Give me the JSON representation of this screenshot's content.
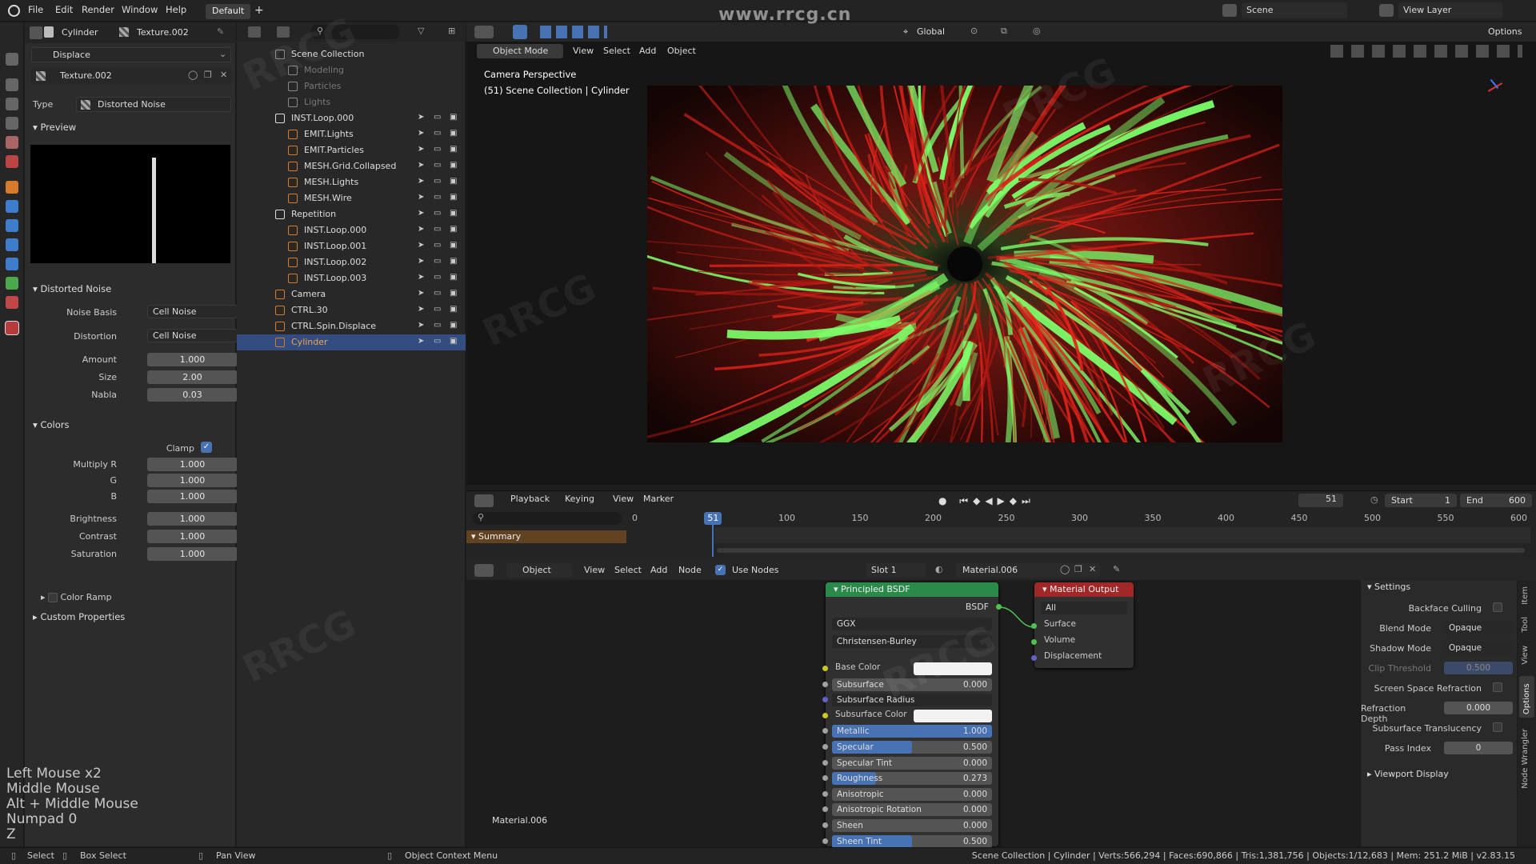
{
  "menu": {
    "items": [
      "File",
      "Edit",
      "Render",
      "Window",
      "Help"
    ],
    "workspace": "Default"
  },
  "topright": {
    "scene": "Scene",
    "view_layer": "View Layer"
  },
  "properties": {
    "object_name": "Cylinder",
    "texture_name": "Texture.002",
    "modifier": "Displace",
    "texture_field": "Texture.002",
    "type_label": "Type",
    "type_value": "Distorted Noise",
    "preview_label": "Preview",
    "noise_section": "Distorted Noise",
    "noise_basis_label": "Noise Basis",
    "noise_basis": "Cell Noise",
    "distortion_label": "Distortion",
    "distortion": "Cell Noise",
    "amount_label": "Amount",
    "amount": "1.000",
    "size_label": "Size",
    "size": "2.00",
    "nabla_label": "Nabla",
    "nabla": "0.03",
    "colors_section": "Colors",
    "clamp_label": "Clamp",
    "mult_r_label": "Multiply R",
    "mult_r": "1.000",
    "g_label": "G",
    "g": "1.000",
    "b_label": "B",
    "b": "1.000",
    "brightness_label": "Brightness",
    "brightness": "1.000",
    "contrast_label": "Contrast",
    "contrast": "1.000",
    "saturation_label": "Saturation",
    "saturation": "1.000",
    "color_ramp_label": "Color Ramp",
    "custom_props": "Custom Properties"
  },
  "keyhints": [
    "Left Mouse x2",
    "Middle Mouse",
    "Alt + Middle Mouse",
    "Numpad 0",
    "Z"
  ],
  "outliner": {
    "rows": [
      {
        "label": "Scene Collection",
        "dim": false
      },
      {
        "label": "Modeling",
        "dim": true
      },
      {
        "label": "Particles",
        "dim": true
      },
      {
        "label": "Lights",
        "dim": true
      },
      {
        "label": "INST.Loop.000",
        "dim": false
      },
      {
        "label": "EMIT.Lights",
        "dim": false
      },
      {
        "label": "EMIT.Particles",
        "dim": false
      },
      {
        "label": "MESH.Grid.Collapsed",
        "dim": false
      },
      {
        "label": "MESH.Lights",
        "dim": false
      },
      {
        "label": "MESH.Wire",
        "dim": false
      },
      {
        "label": "Repetition",
        "dim": false
      },
      {
        "label": "INST.Loop.000",
        "dim": false
      },
      {
        "label": "INST.Loop.001",
        "dim": false
      },
      {
        "label": "INST.Loop.002",
        "dim": false
      },
      {
        "label": "INST.Loop.003",
        "dim": false
      },
      {
        "label": "Camera",
        "dim": false
      },
      {
        "label": "CTRL.30",
        "dim": false
      },
      {
        "label": "CTRL.Spin.Displace",
        "dim": false
      },
      {
        "label": "Cylinder",
        "dim": false
      }
    ]
  },
  "viewport": {
    "mode": "Object Mode",
    "menus": [
      "View",
      "Select",
      "Add",
      "Object"
    ],
    "orientation": "Global",
    "options": "Options",
    "cam_title": "Camera Perspective",
    "cam_sub": "(51) Scene Collection | Cylinder",
    "watermark_top": "www.rrcg.cn"
  },
  "timeline": {
    "menus": [
      "Playback",
      "Keying",
      "View",
      "Marker"
    ],
    "current": "51",
    "start_label": "Start",
    "start": "1",
    "end_label": "End",
    "end": "600",
    "ticks": [
      "0",
      "50",
      "100",
      "150",
      "200",
      "250",
      "300",
      "350",
      "400",
      "450",
      "500",
      "550",
      "600"
    ],
    "summary": "Summary"
  },
  "nodes": {
    "editor": "Object",
    "menus": [
      "View",
      "Select",
      "Add",
      "Node"
    ],
    "use_nodes": "Use Nodes",
    "slot": "Slot 1",
    "material": "Material.006",
    "bsdf_title": "Principled BSDF",
    "bsdf_out": "BSDF",
    "distribution": "GGX",
    "subsurface_method": "Christensen-Burley",
    "fields": [
      {
        "label": "Base Color",
        "type": "color",
        "value": ""
      },
      {
        "label": "Subsurface",
        "type": "num",
        "value": "0.000",
        "fill": 0
      },
      {
        "label": "Subsurface Radius",
        "type": "drop",
        "value": ""
      },
      {
        "label": "Subsurface Color",
        "type": "color",
        "value": ""
      },
      {
        "label": "Metallic",
        "type": "num",
        "value": "1.000",
        "fill": 1
      },
      {
        "label": "Specular",
        "type": "num",
        "value": "0.500",
        "fill": 0.5
      },
      {
        "label": "Specular Tint",
        "type": "num",
        "value": "0.000",
        "fill": 0
      },
      {
        "label": "Roughness",
        "type": "num",
        "value": "0.273",
        "fill": 0.273
      },
      {
        "label": "Anisotropic",
        "type": "num",
        "value": "0.000",
        "fill": 0
      },
      {
        "label": "Anisotropic Rotation",
        "type": "num",
        "value": "0.000",
        "fill": 0
      },
      {
        "label": "Sheen",
        "type": "num",
        "value": "0.000",
        "fill": 0
      },
      {
        "label": "Sheen Tint",
        "type": "num",
        "value": "0.500",
        "fill": 0.5
      }
    ],
    "out_title": "Material Output",
    "out_target": "All",
    "out_sockets": [
      "Surface",
      "Volume",
      "Displacement"
    ],
    "footer_material": "Material.006"
  },
  "settings": {
    "title": "Settings",
    "backface": "Backface Culling",
    "blend_label": "Blend Mode",
    "blend": "Opaque",
    "shadow_label": "Shadow Mode",
    "shadow": "Opaque",
    "clip_label": "Clip Threshold",
    "clip": "0.500",
    "ssr": "Screen Space Refraction",
    "refr_label": "Refraction Depth",
    "refr": "0.000",
    "sst": "Subsurface Translucency",
    "pass_label": "Pass Index",
    "pass": "0",
    "viewport_display": "Viewport Display",
    "tabs": [
      "Item",
      "Tool",
      "View",
      "Options",
      "Node Wrangler"
    ]
  },
  "status": {
    "select": "Select",
    "box": "Box Select",
    "pan": "Pan View",
    "ctx": "Object Context Menu",
    "info": "Scene Collection | Cylinder | Verts:566,294 | Faces:690,866 | Tris:1,381,756 | Objects:1/12,683 | Mem: 251.2 MiB | v2.83.15"
  },
  "colors": {
    "accent": "#4772b3",
    "selected_row": "#334d80",
    "bsdf_header": "#2a8a4a",
    "output_header": "#a02828",
    "summary": "#d67f1d"
  }
}
